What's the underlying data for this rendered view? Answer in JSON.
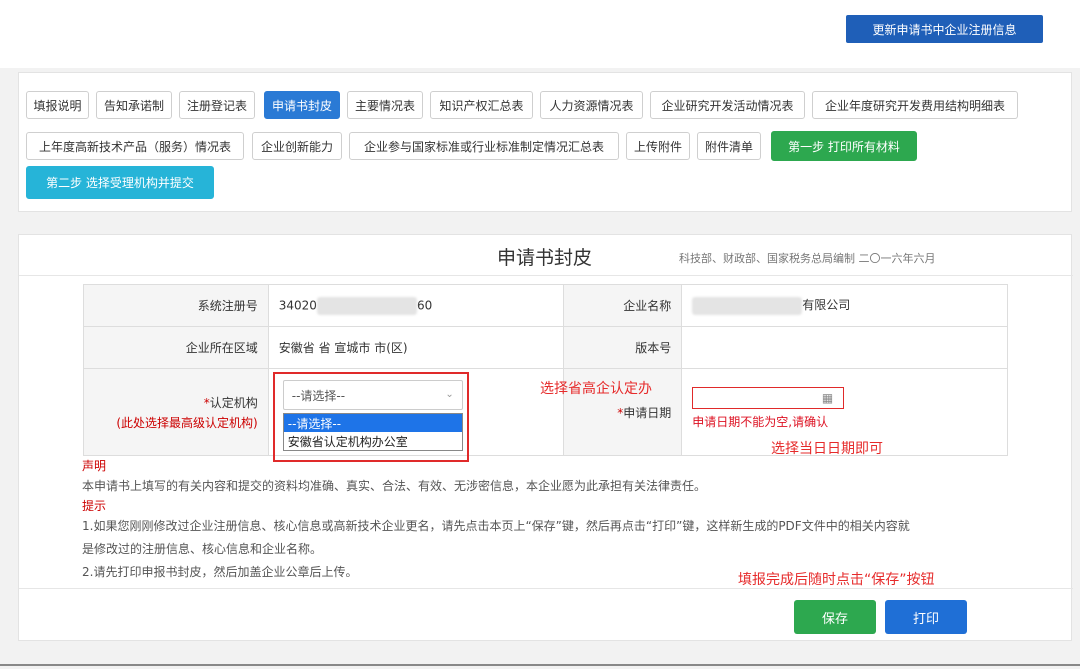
{
  "header": {
    "update_button": "更新申请书中企业注册信息"
  },
  "tabs": [
    "填报说明",
    "告知承诺制",
    "注册登记表",
    "申请书封皮",
    "主要情况表",
    "知识产权汇总表",
    "人力资源情况表",
    "企业研究开发活动情况表",
    "企业年度研究开发费用结构明细表",
    "上年度高新技术产品（服务）情况表",
    "企业创新能力",
    "企业参与国家标准或行业标准制定情况汇总表",
    "上传附件",
    "附件清单",
    "第一步 打印所有材料",
    "第二步 选择受理机构并提交"
  ],
  "active_tab": "申请书封皮",
  "form": {
    "title": "申请书封皮",
    "subtitle": "科技部、财政部、国家税务总局编制 二〇一六年六月",
    "reg_no_label": "系统注册号",
    "reg_no_prefix": "34020",
    "reg_no_suffix": "60",
    "company_label": "企业名称",
    "company_suffix": "有限公司",
    "region_label": "企业所在区域",
    "region_value": "安徽省 省 宣城市 市(区)",
    "version_label": "版本号",
    "version_value": "",
    "agency_label_star": "*",
    "agency_label": "认定机构",
    "agency_note": "(此处选择最高级认定机构)",
    "agency_selected": "--请选择--",
    "agency_options": [
      "--请选择--",
      "安徽省认定机构办公室"
    ],
    "date_label_star": "*",
    "date_label": "申请日期",
    "date_icon_glyph": "▦",
    "date_error": "申请日期不能为空,请确认"
  },
  "annotations": {
    "agency_hint": "选择省高企认定办",
    "date_hint": "选择当日日期即可",
    "save_hint": "填报完成后随时点击“保存”按钮"
  },
  "declaration": {
    "heading": "声明",
    "text": "本申请书上填写的有关内容和提交的资料均准确、真实、合法、有效、无涉密信息，本企业愿为此承担有关法律责任。"
  },
  "tips": {
    "heading": "提示",
    "line1": "1.如果您刚刚修改过企业注册信息、核心信息或高新技术企业更名，请先点击本页上“保存”键，然后再点击“打印”键，这样新生成的PDF文件中的相关内容就",
    "line2": "是修改过的注册信息、核心信息和企业名称。",
    "line3": "2.请先打印申报书封皮，然后加盖企业公章后上传。"
  },
  "actions": {
    "save": "保存",
    "print": "打印"
  }
}
